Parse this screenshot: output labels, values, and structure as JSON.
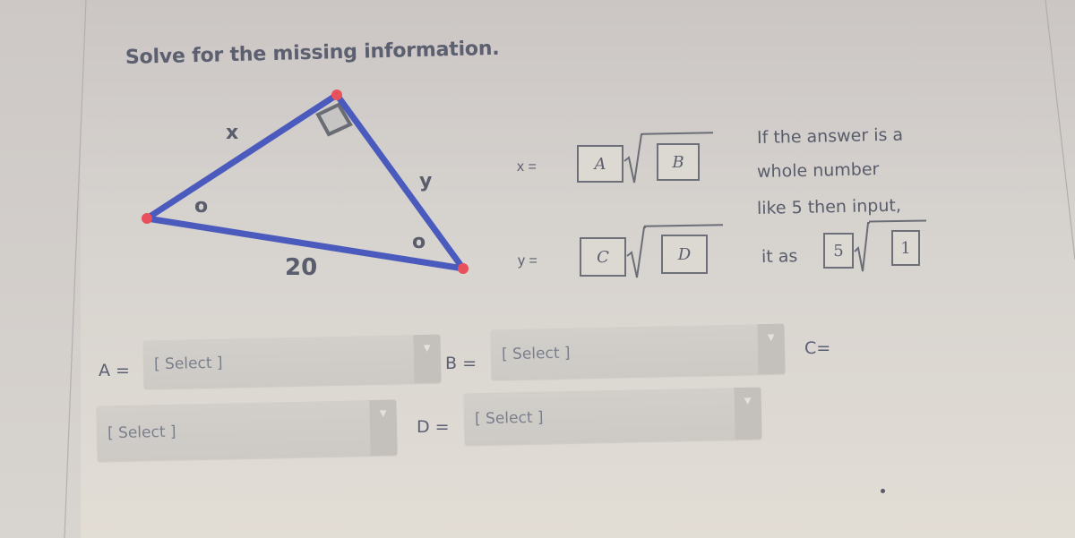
{
  "question": {
    "title": "Solve for the missing information."
  },
  "triangle": {
    "side_labels": {
      "top_left": "x",
      "right": "y",
      "bottom": "20"
    },
    "angle_labels": {
      "left": "o",
      "right": "o"
    },
    "right_angle_at": "top",
    "colors": {
      "edge": "#4a5bbd",
      "vertex": "#e8505b",
      "right_angle_mark": "#6a6c74"
    }
  },
  "formulas": [
    {
      "var_label": "x =",
      "coef_box": "A",
      "radicand_box": "B"
    },
    {
      "var_label": "y =",
      "coef_box": "C",
      "radicand_box": "D"
    }
  ],
  "instruction": {
    "lines": [
      "If the answer is a",
      "whole number",
      "like 5 then input,",
      "it as"
    ],
    "example_coef": "5",
    "example_radicand": "1"
  },
  "answers": [
    {
      "label": "A =",
      "value": "[ Select ]"
    },
    {
      "label": "B =",
      "value": "[ Select ]"
    },
    {
      "label": "C=",
      "value": "[ Select ]"
    },
    {
      "label": "D =",
      "value": "[ Select ]"
    }
  ]
}
